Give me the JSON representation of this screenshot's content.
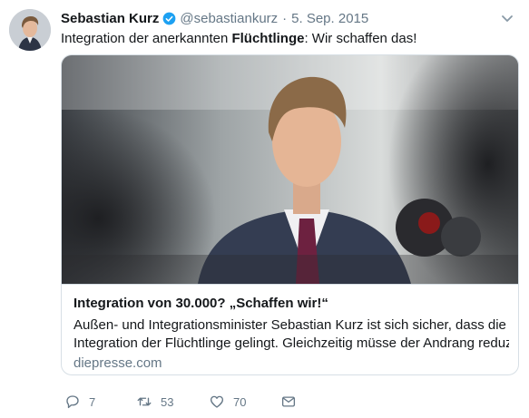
{
  "tweet": {
    "author_name": "Sebastian Kurz",
    "handle": "@sebastiankurz",
    "separator": "·",
    "date": "5. Sep. 2015",
    "text_before": "Integration der anerkannten ",
    "text_bold": "Flüchtlinge",
    "text_after": ": Wir schaffen das!"
  },
  "card": {
    "title": "Integration von 30.000? „Schaffen wir!“",
    "description_line1": "Außen- und Integrationsminister Sebastian Kurz ist sich sicher, dass die",
    "description_line2": "Integration der Flüchtlinge gelingt. Gleichzeitig müsse der Andrang reduz...",
    "domain": "diepresse.com"
  },
  "actions": {
    "reply_count": "7",
    "retweet_count": "53",
    "like_count": "70"
  },
  "icons": [
    "avatar",
    "verified-badge-icon",
    "chevron-down-icon",
    "reply-icon",
    "retweet-icon",
    "like-icon",
    "direct-message-icon"
  ],
  "colors": {
    "verified": "#1da1f2",
    "secondary_text": "#657786",
    "border": "#d7dfe5"
  }
}
